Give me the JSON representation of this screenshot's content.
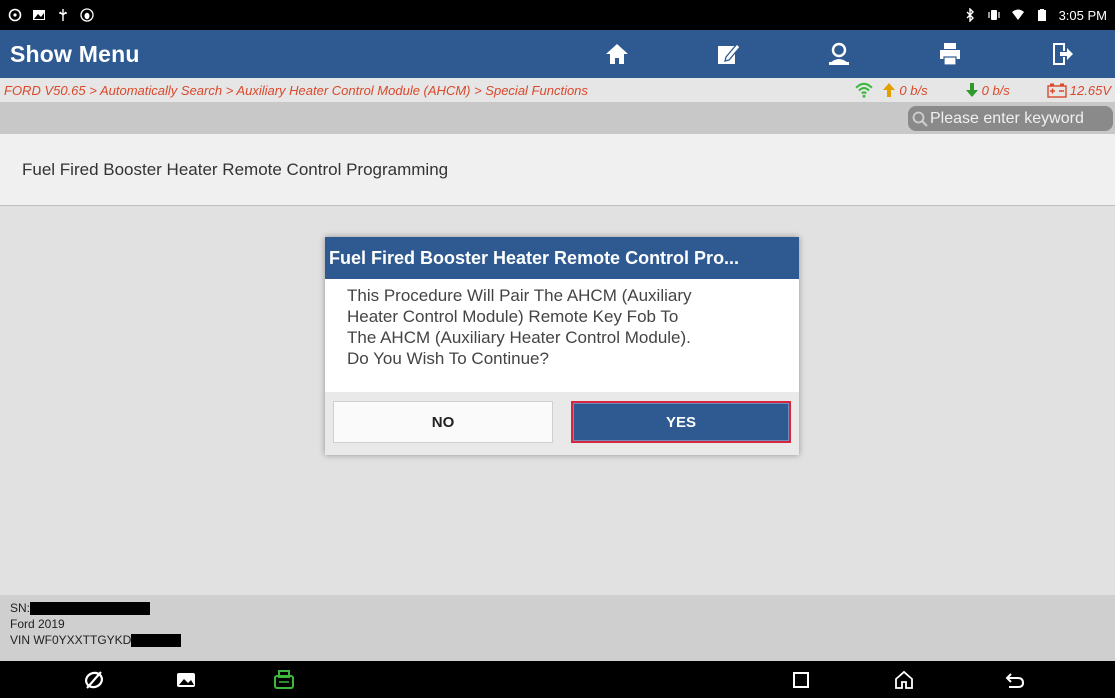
{
  "status_bar": {
    "time": "3:05 PM",
    "left_icons": [
      "chat-icon",
      "image-icon",
      "usb-icon",
      "debug-icon"
    ],
    "right_icons": [
      "bluetooth-icon",
      "vibrate-icon",
      "wifi-icon",
      "battery-icon"
    ]
  },
  "header": {
    "title": "Show Menu",
    "buttons": [
      "home-icon",
      "edit-icon",
      "user-icon",
      "print-icon",
      "exit-icon"
    ]
  },
  "breadcrumb": {
    "path": "FORD V50.65 > Automatically Search > Auxiliary Heater Control Module (AHCM) > Special Functions",
    "upload_rate": "0 b/s",
    "download_rate": "0 b/s",
    "voltage": "12.65V"
  },
  "search": {
    "placeholder": "Please enter keyword"
  },
  "list": {
    "items": [
      {
        "label": "Fuel Fired Booster Heater Remote Control Programming"
      }
    ]
  },
  "footer": {
    "sn_label": "SN:",
    "vehicle": "Ford  2019",
    "vin_label": "VIN WF0YXXTTGYKD"
  },
  "dialog": {
    "title": "Fuel Fired Booster Heater Remote Control Pro...",
    "message_lines": [
      "This Procedure Will Pair The AHCM (Auxiliary",
      "Heater Control Module) Remote Key Fob To",
      "The AHCM (Auxiliary Heater Control Module).",
      "Do You Wish To Continue?"
    ],
    "no_label": "NO",
    "yes_label": "YES"
  },
  "nav_bar": {
    "icons": [
      "browser-icon",
      "gallery-icon",
      "vci-icon",
      "recents-icon",
      "home-nav-icon",
      "back-icon"
    ]
  },
  "colors": {
    "header_bg": "#2f5a91",
    "breadcrumb_text": "#d9482b",
    "yes_border": "#d9263e",
    "rate_up": "#e0a000",
    "rate_down": "#2e9a2e",
    "wifi": "#3db83d"
  }
}
